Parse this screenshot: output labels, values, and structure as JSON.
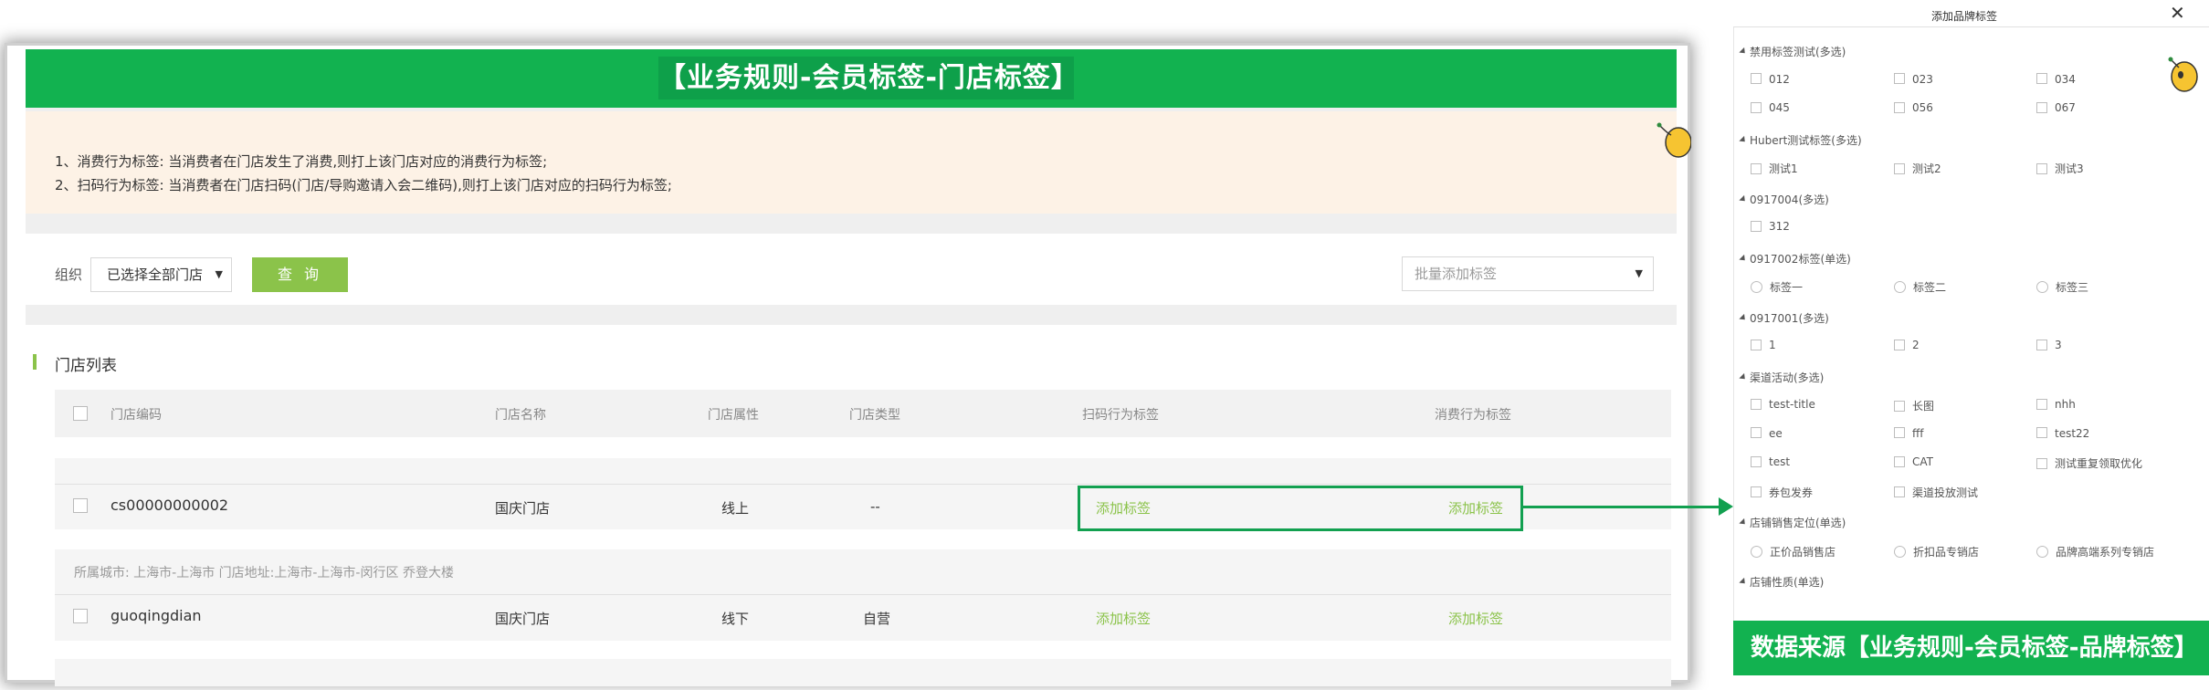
{
  "colors": {
    "brand_green": "#12b250",
    "accent_green": "#8bc34a",
    "notice_bg": "#fdf2e6",
    "highlight": "#12a050"
  },
  "main": {
    "banner_title": "【业务规则-会员标签-门店标签】",
    "notice": [
      "1、消费行为标签: 当消费者在门店发生了消费,则打上该门店对应的消费行为标签;",
      "2、扫码行为标签: 当消费者在门店扫码(门店/导购邀请入会二维码),则打上该门店对应的扫码行为标签;"
    ],
    "filter": {
      "org_label": "组织",
      "org_value": "已选择全部门店",
      "query_label": "查 询",
      "batch_placeholder": "批量添加标签"
    },
    "list": {
      "title": "门店列表",
      "columns": [
        "门店编码",
        "门店名称",
        "门店属性",
        "门店类型",
        "扫码行为标签",
        "消费行为标签"
      ],
      "rows": [
        {
          "code": "cs00000000002",
          "name": "国庆门店",
          "attr": "线上",
          "type": "--",
          "scan_tag": "添加标签",
          "consume_tag": "添加标签"
        },
        {
          "meta": "所属城市: 上海市-上海市   门店地址:上海市-上海市-闵行区 乔登大楼",
          "code": "guoqingdian",
          "name": "国庆门店",
          "attr": "线下",
          "type": "自营",
          "scan_tag": "添加标签",
          "consume_tag": "添加标签"
        }
      ]
    }
  },
  "dialog": {
    "title": "添加品牌标签",
    "close": "✕",
    "groups": [
      {
        "label": "禁用标签测试(多选)",
        "kind": "checkbox",
        "options": [
          "012",
          "023",
          "034",
          "045",
          "056",
          "067"
        ]
      },
      {
        "label": "Hubert测试标签(多选)",
        "kind": "checkbox",
        "options": [
          "测试1",
          "测试2",
          "测试3"
        ]
      },
      {
        "label": "0917004(多选)",
        "kind": "checkbox",
        "options": [
          "312"
        ]
      },
      {
        "label": "0917002标签(单选)",
        "kind": "radio",
        "options": [
          "标签一",
          "标签二",
          "标签三"
        ]
      },
      {
        "label": "0917001(多选)",
        "kind": "checkbox",
        "options": [
          "1",
          "2",
          "3"
        ]
      },
      {
        "label": "渠道活动(多选)",
        "kind": "checkbox",
        "options": [
          "test-title",
          "长图",
          "nhh",
          "ee",
          "fff",
          "test22",
          "test",
          "CAT",
          "测试重复领取优化",
          "券包发券",
          "渠道投放测试"
        ]
      },
      {
        "label": "店铺销售定位(单选)",
        "kind": "radio",
        "options": [
          "正价品销售店",
          "折扣品专销店",
          "品牌高端系列专销店"
        ]
      },
      {
        "label": "店铺性质(单选)",
        "kind": "radio",
        "options": []
      }
    ]
  },
  "source_banner": "数据来源【业务规则-会员标签-品牌标签】"
}
